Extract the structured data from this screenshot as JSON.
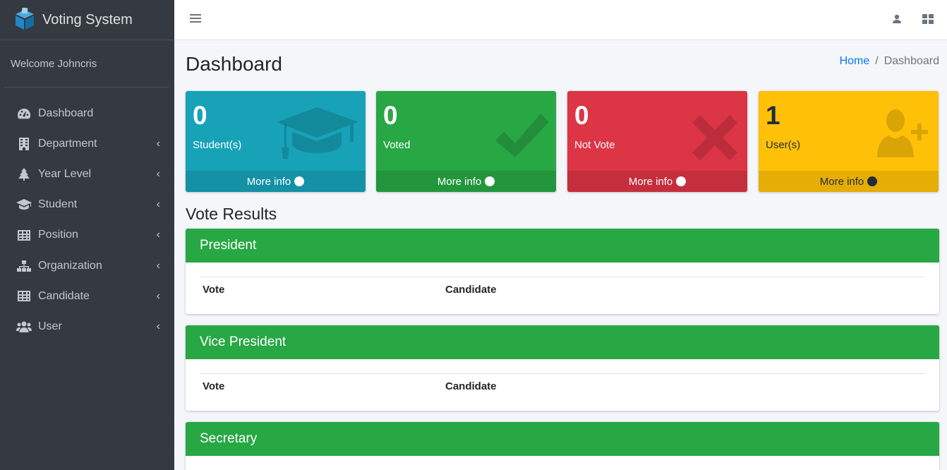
{
  "brand": {
    "title": "Voting System",
    "accent": "#1e88c8"
  },
  "user_panel": {
    "welcome": "Welcome Johncris"
  },
  "sidebar": {
    "items": [
      {
        "label": "Dashboard",
        "icon": "tachometer-icon",
        "has_submenu": false
      },
      {
        "label": "Department",
        "icon": "building-icon",
        "has_submenu": true
      },
      {
        "label": "Year Level",
        "icon": "tree-icon",
        "has_submenu": true
      },
      {
        "label": "Student",
        "icon": "graduation-cap-icon",
        "has_submenu": true
      },
      {
        "label": "Position",
        "icon": "table-icon",
        "has_submenu": true
      },
      {
        "label": "Organization",
        "icon": "sitemap-icon",
        "has_submenu": true
      },
      {
        "label": "Candidate",
        "icon": "table-icon",
        "has_submenu": true
      },
      {
        "label": "User",
        "icon": "users-icon",
        "has_submenu": true
      }
    ]
  },
  "topbar": {
    "menu_icon": "hamburger-icon",
    "user_icon": "user-icon",
    "apps_icon": "grid-icon"
  },
  "page": {
    "title": "Dashboard",
    "breadcrumb": {
      "home": "Home",
      "separator": "/",
      "current": "Dashboard"
    }
  },
  "stats": [
    {
      "value": "0",
      "label": "Student(s)",
      "footer": "More info",
      "color": "#17a2b8",
      "icon": "graduation-cap-icon"
    },
    {
      "value": "0",
      "label": "Voted",
      "footer": "More info",
      "color": "#28a745",
      "icon": "check-icon"
    },
    {
      "value": "0",
      "label": "Not Vote",
      "footer": "More info",
      "color": "#dc3545",
      "icon": "times-icon"
    },
    {
      "value": "1",
      "label": "User(s)",
      "footer": "More info",
      "color": "#ffc107",
      "icon": "user-plus-icon"
    }
  ],
  "results": {
    "title": "Vote Results",
    "columns": {
      "vote": "Vote",
      "candidate": "Candidate"
    },
    "positions": [
      {
        "name": "President"
      },
      {
        "name": "Vice President"
      },
      {
        "name": "Secretary"
      }
    ]
  }
}
